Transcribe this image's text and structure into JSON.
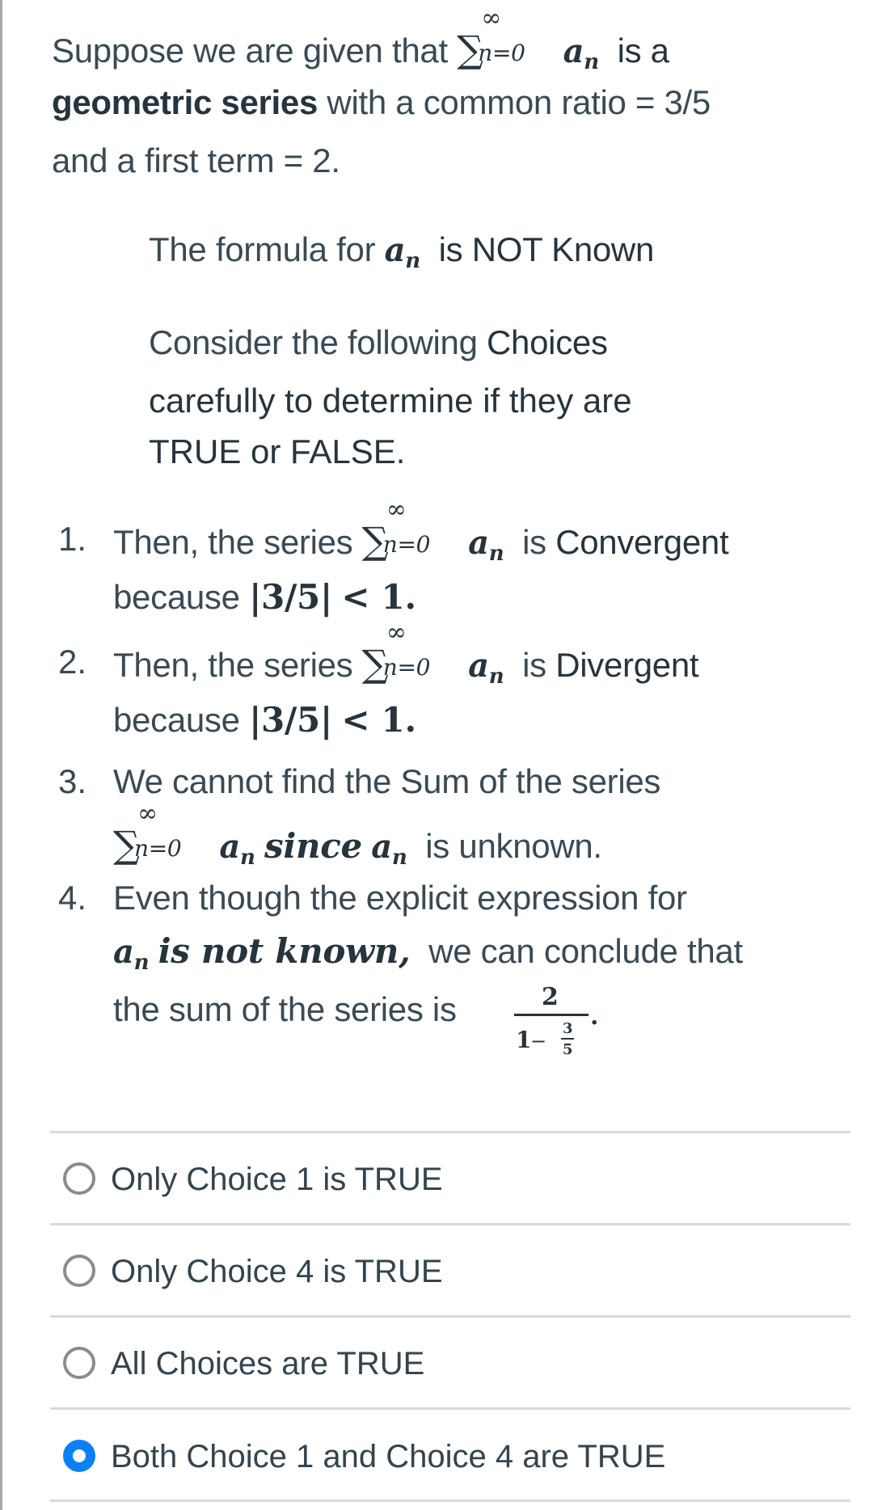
{
  "intro": {
    "line1_pre": "Suppose we are given that",
    "sum_sup": "∞",
    "sum_sub": "n=0",
    "a": "a",
    "n": "n",
    "line1_post": "is a",
    "line2_bold": "geometric series",
    "line2_rest": "with a common ratio = 3/5",
    "line3": "and a first term = 2."
  },
  "note": {
    "formula_pre": "The formula for",
    "formula_post": "is NOT Known",
    "consider_pre": "Consider the following",
    "consider_bold": "Choices",
    "line2": "carefully to determine if they are",
    "line3": "TRUE or FALSE."
  },
  "choices": [
    {
      "number": "1.",
      "pre": "Then, the series",
      "post_light": "is",
      "post_bold": "Convergent",
      "because": "because",
      "abs": "|3/5|",
      "lt": "< 1."
    },
    {
      "number": "2.",
      "pre": "Then, the series",
      "post_light": "is",
      "post_bold": "Divergent",
      "because": "because",
      "abs": "|3/5|",
      "lt": "< 1."
    },
    {
      "number": "3.",
      "line1": "We cannot find the Sum of the series",
      "since": "since",
      "post": "is unknown."
    },
    {
      "number": "4.",
      "line1": "Even though the explicit expression for",
      "math_phrase": "is not known,",
      "line2_post": "we can conclude that",
      "line3": "the sum of the series is",
      "frac_num": "2",
      "frac_den_whole": "1",
      "frac_den_minus": "−",
      "frac_inner_num": "3",
      "frac_inner_den": "5",
      "period": "."
    }
  ],
  "options": [
    {
      "label": "Only Choice 1 is TRUE",
      "selected": false
    },
    {
      "label": "Only Choice 4 is TRUE",
      "selected": false
    },
    {
      "label": "All Choices are TRUE",
      "selected": false
    },
    {
      "label": "Both Choice 1 and Choice 4 are TRUE",
      "selected": true
    }
  ],
  "colors": {
    "text": "#2d3b45",
    "radio_selected": "#0b80f6",
    "radio_unselected": "#8c8c8c",
    "divider": "#dadada"
  }
}
